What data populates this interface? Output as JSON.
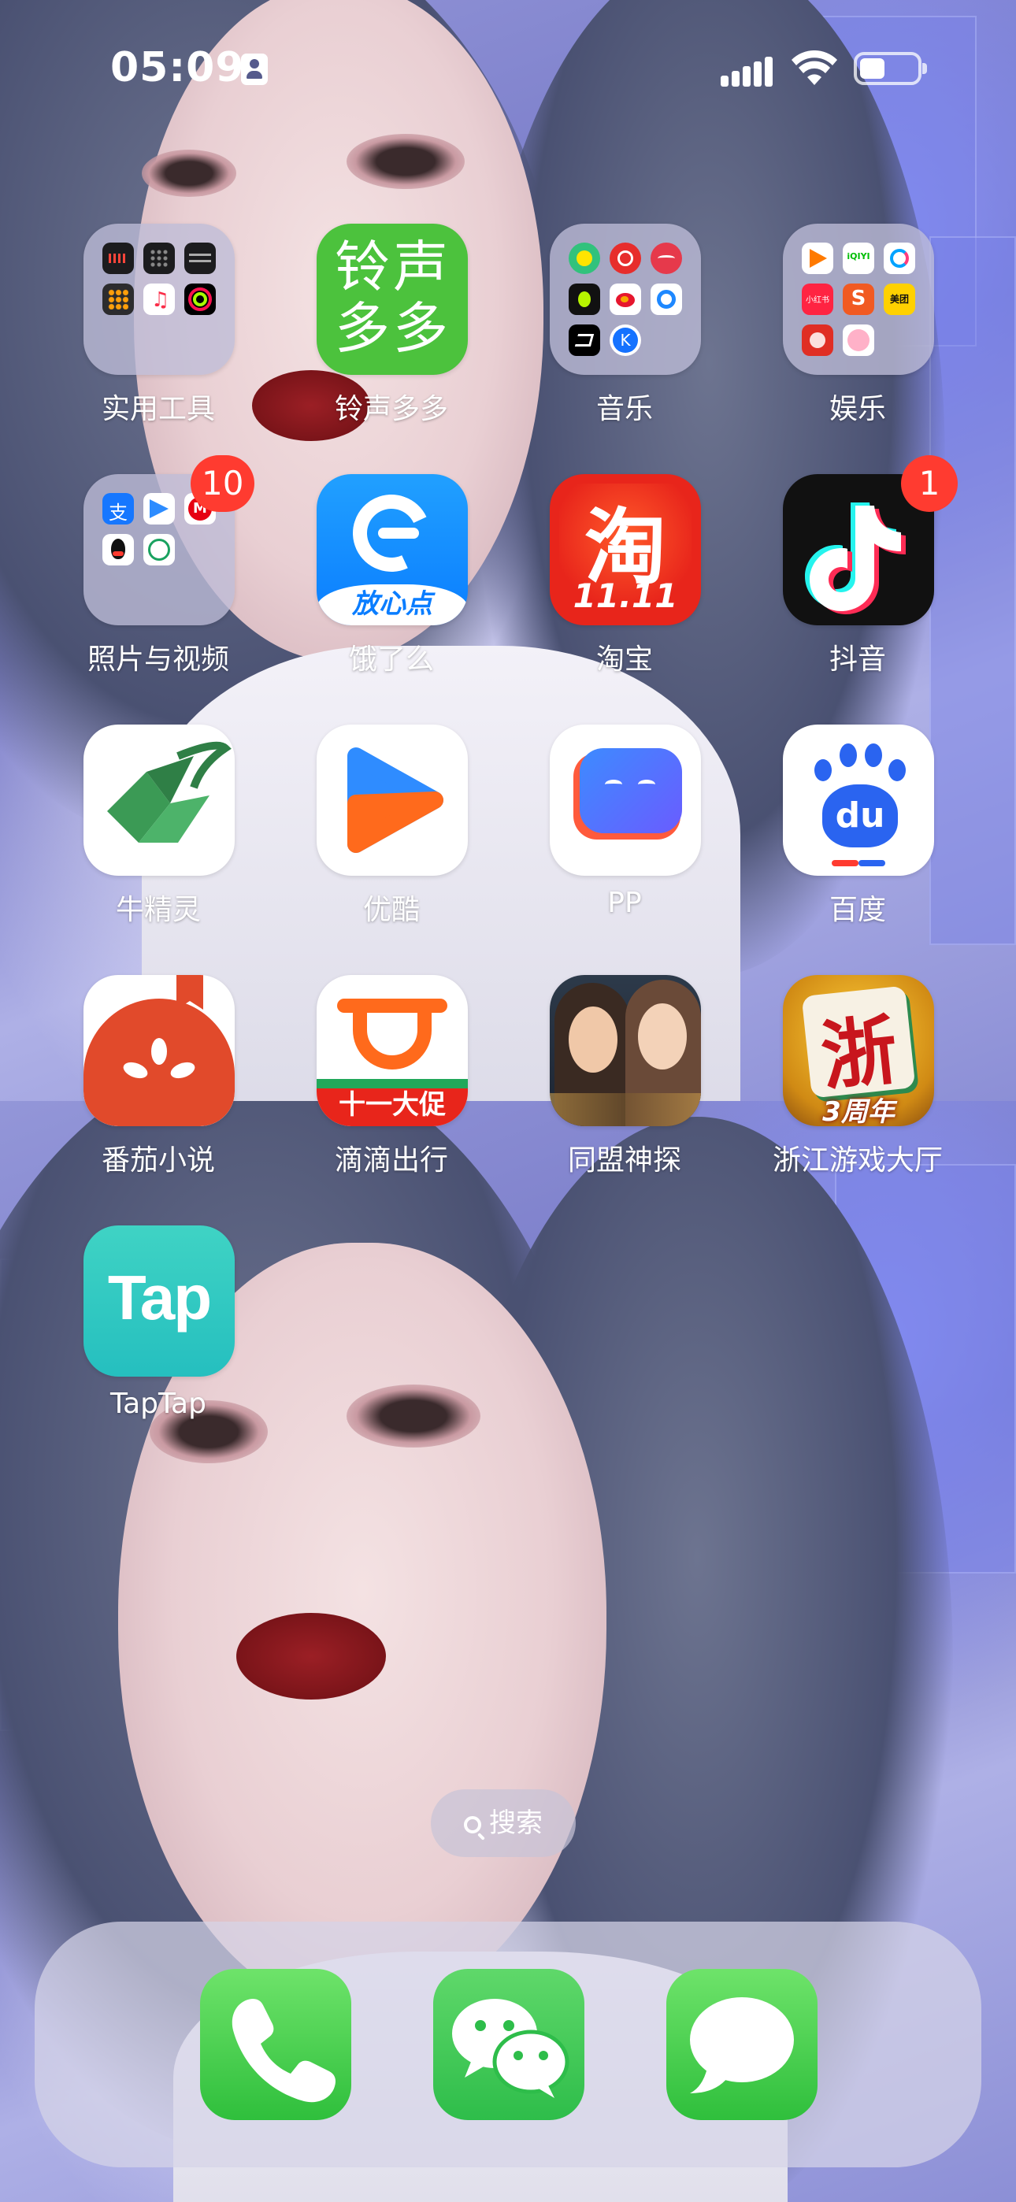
{
  "status_bar": {
    "time": "05:09",
    "icons": [
      "contact-card-icon",
      "cellular-signal-icon",
      "wifi-icon",
      "battery-icon"
    ],
    "battery_level": 0.4
  },
  "apps": [
    {
      "id": "utilities",
      "label": "实用工具",
      "type": "folder",
      "badge": null
    },
    {
      "id": "lingsheng",
      "label": "铃声多多",
      "type": "app",
      "icon_text": "铃声多多",
      "badge": null
    },
    {
      "id": "music",
      "label": "音乐",
      "type": "folder",
      "badge": null
    },
    {
      "id": "entertainment",
      "label": "娱乐",
      "type": "folder",
      "badge": null
    },
    {
      "id": "photos-videos",
      "label": "照片与视频",
      "type": "folder",
      "badge": "10"
    },
    {
      "id": "eleme",
      "label": "饿了么",
      "type": "app",
      "icon_text": "放心点",
      "badge": null
    },
    {
      "id": "taobao",
      "label": "淘宝",
      "type": "app",
      "icon_text": "淘",
      "icon_subtext": "11.11",
      "badge": null
    },
    {
      "id": "douyin",
      "label": "抖音",
      "type": "app",
      "badge": "1"
    },
    {
      "id": "niujingling",
      "label": "牛精灵",
      "type": "app",
      "badge": null
    },
    {
      "id": "youku",
      "label": "优酷",
      "type": "app",
      "badge": null
    },
    {
      "id": "pp",
      "label": "PP",
      "type": "app",
      "badge": null
    },
    {
      "id": "baidu",
      "label": "百度",
      "type": "app",
      "icon_text": "du",
      "badge": null
    },
    {
      "id": "fanqie",
      "label": "番茄小说",
      "type": "app",
      "badge": null
    },
    {
      "id": "didi",
      "label": "滴滴出行",
      "type": "app",
      "icon_text": "十一大促",
      "badge": null
    },
    {
      "id": "tongmeng",
      "label": "同盟神探",
      "type": "app",
      "badge": null
    },
    {
      "id": "zhejiang-games",
      "label": "浙江游戏大厅",
      "type": "app",
      "icon_text": "浙",
      "icon_subtext": "3周年",
      "badge": null
    },
    {
      "id": "taptap",
      "label": "TapTap",
      "type": "app",
      "icon_text": "Tap",
      "badge": null
    }
  ],
  "folder_minis": {
    "utilities": [
      "voice-memos-icon",
      "calculator-dots-icon",
      "stocks-icon",
      "calculator-icon",
      "music-note-icon",
      "activity-rings-icon"
    ],
    "music": [
      "qq-music-icon",
      "netease-music-icon",
      "kugou-icon",
      "qishui-icon",
      "weibo-icon",
      "blue-app-icon",
      "capcut-icon",
      "kuwo-icon"
    ],
    "entertainment": [
      "tencent-video-icon",
      "iqiyi-icon",
      "migu-icon",
      "xiaohongshu-icon",
      "sohu-icon",
      "meituan-icon",
      "pinduoduo-icon",
      "pink-app-icon"
    ],
    "photos-videos": [
      "alipay-icon",
      "blue-arrow-icon",
      "metro-icon",
      "qq-icon",
      "green-app-icon"
    ]
  },
  "mini_labels": {
    "iqiyi": "iQIYI",
    "xiaohongshu": "小红书",
    "meituan": "美团",
    "sohu": "S",
    "alipay": "支"
  },
  "search": {
    "label": "搜索"
  },
  "dock": [
    {
      "id": "phone",
      "icon": "phone-icon"
    },
    {
      "id": "wechat",
      "icon": "wechat-icon"
    },
    {
      "id": "messages",
      "icon": "messages-icon"
    }
  ],
  "colors": {
    "badge": "#ff3b30",
    "lingsheng_green": "#4cc23d",
    "eleme_blue": "#1e90ff",
    "taobao_red": "#e8251b",
    "douyin_black": "#111111",
    "fanqie_red": "#e14a2b",
    "didi_orange": "#ff6a1c",
    "taptap_teal": "#3cd0c4",
    "dock_green": "#34c759"
  }
}
